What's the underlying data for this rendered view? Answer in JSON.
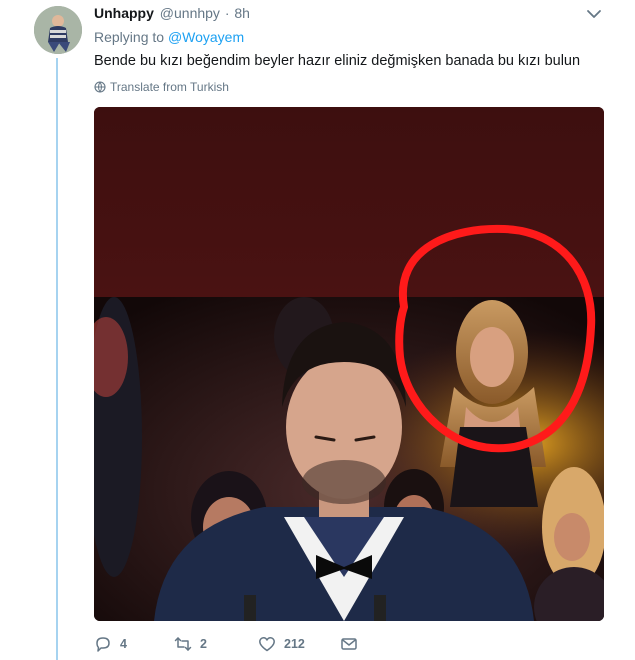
{
  "tweet": {
    "display_name": "Unhappy",
    "handle": "@unnhpy",
    "separator": "·",
    "time": "8h",
    "replying_prefix": "Replying to",
    "replying_to": "@Woyayem",
    "text": "Bende bu kızı beğendim beyler hazır eliniz değmişken banada bu kızı bulun",
    "translate_label": "Translate from Turkish",
    "media_alt": "TV broadcast still of a man in a tuxedo at a podium with a woman circled in red in the audience"
  },
  "actions": {
    "replies": "4",
    "retweets": "2",
    "likes": "212"
  },
  "icons": {
    "avatar": "avatar-image",
    "caret": "chevron-down-icon",
    "globe": "globe-icon",
    "reply": "reply-icon",
    "retweet": "retweet-icon",
    "like": "heart-icon",
    "dm": "envelope-icon"
  },
  "colors": {
    "link": "#1da1f2",
    "secondary_text": "#657786",
    "thread_line": "#a6d3f0",
    "highlight_circle": "#ff1a1a"
  }
}
